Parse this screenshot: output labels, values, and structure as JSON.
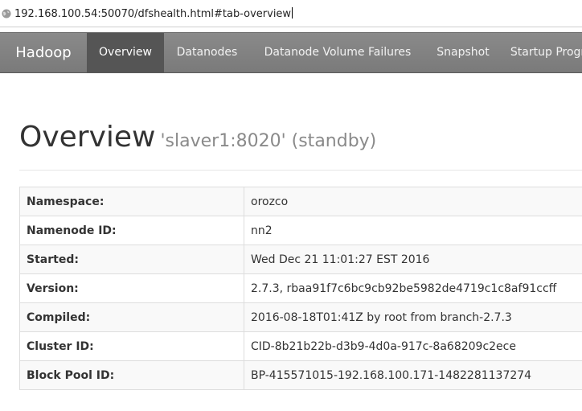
{
  "browser": {
    "url": "192.168.100.54:50070/dfshealth.html#tab-overview",
    "globe_icon": "globe-icon"
  },
  "navbar": {
    "brand": "Hadoop",
    "items": [
      {
        "label": "Overview",
        "active": true
      },
      {
        "label": "Datanodes",
        "active": false
      },
      {
        "label": "Datanode Volume Failures",
        "active": false
      },
      {
        "label": "Snapshot",
        "active": false
      },
      {
        "label": "Startup Progress",
        "active": false
      }
    ]
  },
  "page": {
    "title": "Overview",
    "subtitle": "'slaver1:8020' (standby)"
  },
  "overview_table": [
    {
      "key": "Namespace:",
      "value": "orozco"
    },
    {
      "key": "Namenode ID:",
      "value": "nn2"
    },
    {
      "key": "Started:",
      "value": "Wed Dec 21 11:01:27 EST 2016"
    },
    {
      "key": "Version:",
      "value": "2.7.3, rbaa91f7c6bc9cb92be5982de4719c1c8af91ccff"
    },
    {
      "key": "Compiled:",
      "value": "2016-08-18T01:41Z by root from branch-2.7.3"
    },
    {
      "key": "Cluster ID:",
      "value": "CID-8b21b22b-d3b9-4d0a-917c-8a68209c2ece"
    },
    {
      "key": "Block Pool ID:",
      "value": "BP-415571015-192.168.100.171-1482281137274"
    }
  ],
  "colors": {
    "navbar_bg": "#7f7f7f",
    "navbar_active": "#555555",
    "subtitle": "#8a8a8a"
  }
}
